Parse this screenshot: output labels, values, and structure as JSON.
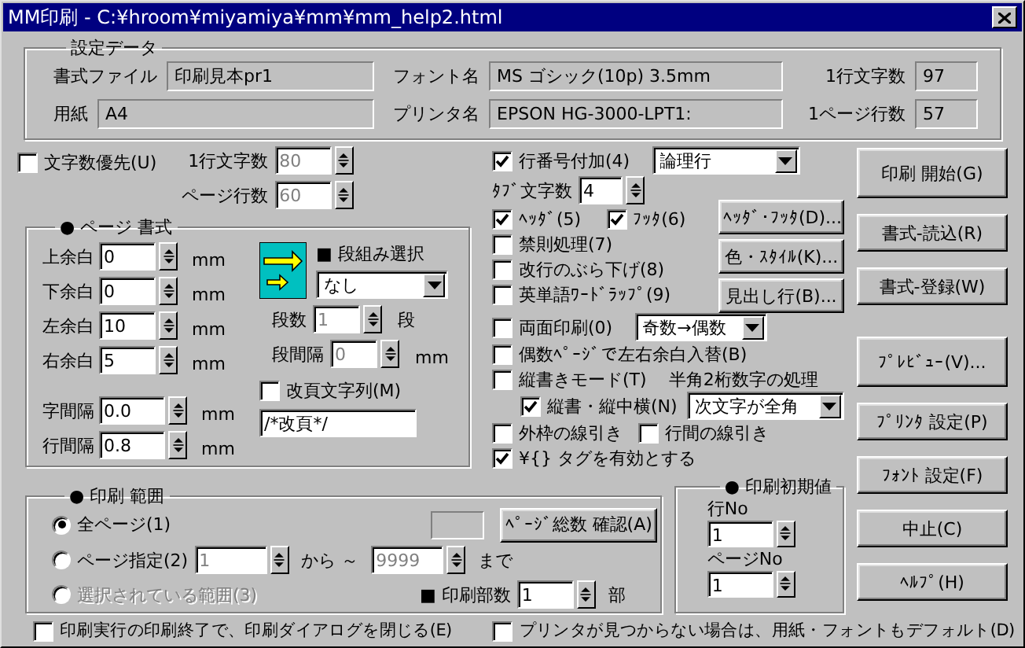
{
  "window": {
    "title": "MM印刷 - C:¥hroom¥miyamiya¥mm¥mm_help2.html"
  },
  "settings": {
    "title": "設定データ",
    "rows": [
      {
        "fields": [
          {
            "label": "書式ファイル",
            "value": "印刷見本pr1"
          },
          {
            "label": "フォント名",
            "value": "MS ゴシック(10p) 3.5mm"
          },
          {
            "label": "1行文字数",
            "value": "97"
          }
        ]
      },
      {
        "fields": [
          {
            "label": "用紙",
            "value": "A4"
          },
          {
            "label": "プリンタ名",
            "value": "EPSON HG-3000-LPT1:"
          },
          {
            "label": "1ページ行数",
            "value": "57"
          }
        ]
      }
    ]
  },
  "char_priority": {
    "label": "文字数優先(U)",
    "checked": false
  },
  "char_counts": [
    {
      "label": "1行文字数",
      "value": "80",
      "disabled": true
    },
    {
      "label": "ページ行数",
      "value": "60",
      "disabled": true
    }
  ],
  "page_format": {
    "title": "● ページ 書式",
    "margins": [
      {
        "label": "上余白",
        "value": "0",
        "unit": "mm"
      },
      {
        "label": "下余白",
        "value": "0",
        "unit": "mm"
      },
      {
        "label": "左余白",
        "value": "10",
        "unit": "mm"
      },
      {
        "label": "右余白",
        "value": "5",
        "unit": "mm"
      }
    ],
    "spacing": [
      {
        "label": "字間隔",
        "value": "0.0",
        "unit": "mm"
      },
      {
        "label": "行間隔",
        "value": "0.8",
        "unit": "mm"
      }
    ],
    "columns_title": "■ 段組み選択",
    "columns_select": "なし",
    "column_count": {
      "label": "段数",
      "value": "1",
      "unit": "段",
      "disabled": true
    },
    "column_gap": {
      "label": "段間隔",
      "value": "0",
      "unit": "mm",
      "disabled": true
    },
    "page_break": {
      "label": "改頁文字列(M)",
      "checked": false,
      "value": "/*改頁*/"
    }
  },
  "line_numbers": {
    "label": "行番号付加(4)",
    "checked": true,
    "select": "論理行"
  },
  "tab_chars": {
    "label": "ﾀﾌﾞ文字数",
    "value": "4"
  },
  "header_footer": [
    {
      "label": "ﾍｯﾀﾞ(5)",
      "checked": true
    },
    {
      "label": "ﾌｯﾀ(6)",
      "checked": true
    }
  ],
  "options": [
    {
      "label": "禁則処理(7)",
      "checked": false
    },
    {
      "label": "改行のぶら下げ(8)",
      "checked": false
    },
    {
      "label": "英単語ﾜｰﾄﾞﾗｯﾌﾟ(9)",
      "checked": false
    }
  ],
  "style_buttons": [
    "ﾍｯﾀﾞ･ﾌｯﾀ(D)...",
    "色・ｽﾀｲﾙ(K)...",
    "見出し行(B)..."
  ],
  "duplex": {
    "label": "両面印刷(0)",
    "checked": false,
    "select": "奇数→偶数"
  },
  "swap_margins": {
    "label": "偶数ﾍﾟｰｼﾞで左右余白入替(B)",
    "checked": false
  },
  "vertical": {
    "label": "縦書きモード(T)",
    "checked": false
  },
  "digits": {
    "title": "半角2桁数字の処理",
    "label": "縦書・縦中横(N)",
    "checked": true,
    "select": "次文字が全角"
  },
  "rules": [
    {
      "label": "外枠の線引き",
      "checked": false
    },
    {
      "label": "行間の線引き",
      "checked": false
    }
  ],
  "tags": {
    "label": "¥{} タグを有効とする",
    "checked": true
  },
  "actions": [
    "印刷 開始(G)",
    "書式-読込(R)",
    "書式-登録(W)",
    "ﾌﾟﾚﾋﾞｭｰ(V)...",
    "ﾌﾟﾘﾝﾀ 設定(P)",
    "ﾌｫﾝﾄ 設定(F)",
    "中止(C)",
    "ﾍﾙﾌﾟ(H)"
  ],
  "print_range": {
    "title": "● 印刷 範囲",
    "radios": [
      {
        "label": "全ページ(1)",
        "selected": true,
        "disabled": false
      },
      {
        "label": "ページ指定(2)",
        "selected": false,
        "disabled": false
      },
      {
        "label": "選択されている範囲(3)",
        "selected": false,
        "disabled": true
      }
    ],
    "page_total_button": "ﾍﾟｰｼﾞ総数 確認(A)",
    "from": {
      "value": "1",
      "disabled": true
    },
    "from_label": "から ～",
    "to": {
      "value": "9999",
      "disabled": true
    },
    "to_label": "まで",
    "copies": {
      "label": "■ 印刷部数",
      "value": "1",
      "unit": "部"
    }
  },
  "initial_values": {
    "title": "● 印刷初期値",
    "fields": [
      {
        "label": "行No",
        "value": "1"
      },
      {
        "label": "ページNo",
        "value": "1"
      }
    ]
  },
  "bottom_options": [
    {
      "label": "印刷実行の印刷終了で、印刷ダイアログを閉じる(E)",
      "checked": false
    },
    {
      "label": "プリンタが見つからない場合は、用紙・フォントもデフォルト(D)",
      "checked": false
    }
  ]
}
